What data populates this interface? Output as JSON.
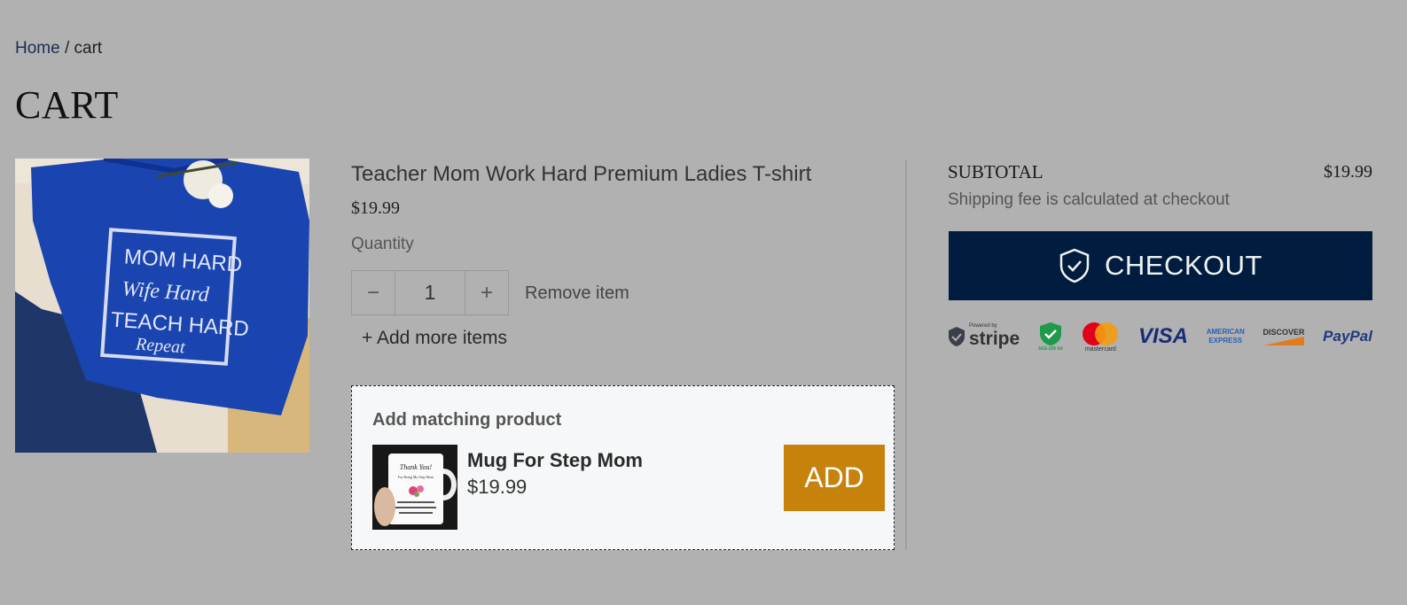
{
  "breadcrumb": {
    "home": "Home",
    "separator": "/",
    "current": "cart"
  },
  "page_title": "CART",
  "cart_item": {
    "image_text": [
      "MOM HARD",
      "Wife Hard",
      "TEACH HARD",
      "Repeat"
    ],
    "name": "Teacher Mom Work Hard Premium Ladies T-shirt",
    "price": "$19.99",
    "quantity_label": "Quantity",
    "quantity_value": "1",
    "decrement": "−",
    "increment": "+",
    "remove_label": "Remove item",
    "add_more_label": "+ Add more items"
  },
  "upsell": {
    "title": "Add matching product",
    "name": "Mug For Step Mom",
    "price": "$19.99",
    "add_label": "ADD",
    "add_color": "#c6820b",
    "mug_text": [
      "Thank You!",
      "For Being My Step Mom"
    ]
  },
  "summary": {
    "subtotal_label": "SUBTOTAL",
    "subtotal_value": "$19.99",
    "shipping_note": "Shipping fee is calculated at checkout",
    "checkout_label": "CHECKOUT",
    "checkout_color": "#001d40",
    "checkout_icon": "shield-check-icon"
  },
  "payments": {
    "stripe_small": "Powered by",
    "stripe": "stripe",
    "ssl": "AES-256 bit",
    "mastercard": "mastercard",
    "visa": "VISA",
    "amex_top": "AMERICAN",
    "amex_bottom": "EXPRESS",
    "discover": "DISCOVER",
    "paypal": "PayPal"
  }
}
